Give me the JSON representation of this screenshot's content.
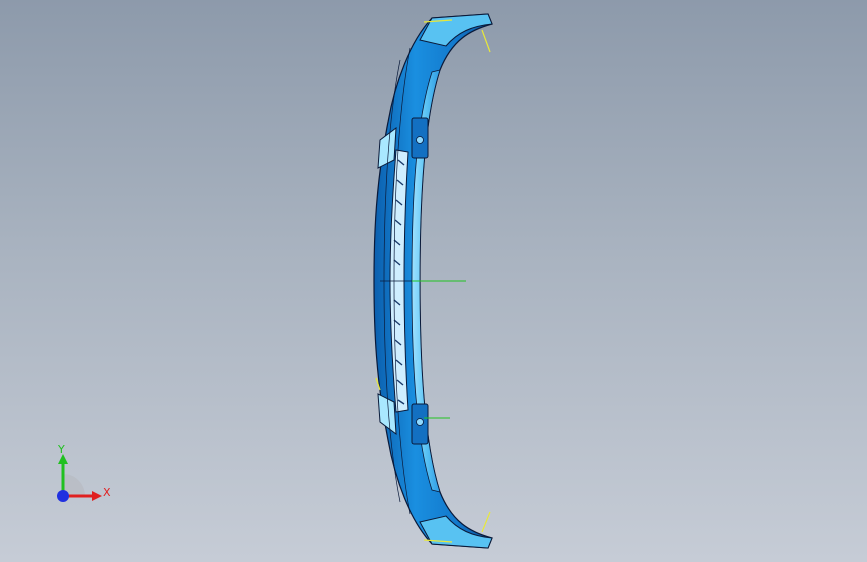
{
  "viewport": {
    "background_top": "#8d9aab",
    "background_bottom": "#c6ccd6"
  },
  "model": {
    "part": "front-bumper-lip",
    "body_color": "#1689d6",
    "highlight_color": "#7fd4ff",
    "edge_color": "#0a1a3a",
    "sketch_line_color": "#e8e83a",
    "origin_line_color": "#21c421"
  },
  "triad": {
    "x_label": "X",
    "y_label": "Y",
    "x_color": "#e02020",
    "y_color": "#20c020",
    "z_color": "#2030e0"
  }
}
